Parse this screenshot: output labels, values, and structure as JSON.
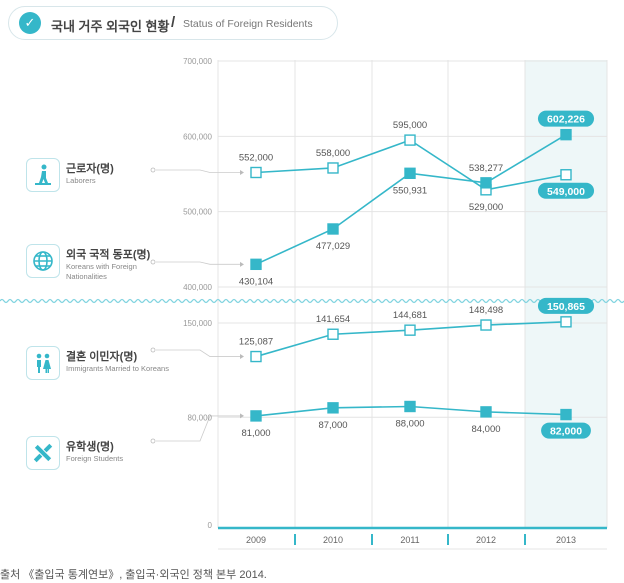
{
  "title": {
    "ko": "국내 거주 외국인 현황",
    "sep": "/",
    "en": "Status of Foreign Residents"
  },
  "categories": [
    {
      "ko": "근로자(명)",
      "en": "Laborers",
      "icon": "worker-icon"
    },
    {
      "ko": "외국 국적 동포(명)",
      "en": "Koreans with Foreign Nationalities",
      "icon": "globe-icon"
    },
    {
      "ko": "결혼 이민자(명)",
      "en": "Immigrants Married to Koreans",
      "icon": "couple-icon"
    },
    {
      "ko": "유학생(명)",
      "en": "Foreign Students",
      "icon": "pencil-ruler-icon"
    }
  ],
  "source": "출처 《출입국 통계연보》, 출입국·외국인 정책 본부 2014.",
  "colors": {
    "accent": "#35b7c9",
    "grid": "#e4e4e4",
    "highlight_bg": "#eef7f8"
  },
  "chart_data": [
    {
      "type": "line",
      "x": [
        "2009",
        "2010",
        "2011",
        "2012",
        "2013"
      ],
      "ylim": [
        400000,
        700000
      ],
      "ticks": [
        "400,000",
        "500,000",
        "600,000",
        "700,000"
      ],
      "grid": true,
      "series": [
        {
          "name": "근로자(명)",
          "marker": "hollow-square",
          "values": [
            552000,
            558000,
            595000,
            529000,
            549000
          ],
          "labels": [
            "552,000",
            "558,000",
            "595,000",
            "529,000",
            "549,000"
          ]
        },
        {
          "name": "외국 국적 동포(명)",
          "marker": "filled-square",
          "values": [
            430104,
            477029,
            550931,
            538277,
            602226
          ],
          "labels": [
            "430,104",
            "477,029",
            "550,931",
            "538,277",
            "602,226"
          ]
        }
      ]
    },
    {
      "type": "line",
      "x": [
        "2009",
        "2010",
        "2011",
        "2012",
        "2013"
      ],
      "ylim": [
        0,
        150000
      ],
      "ticks": [
        "0",
        "80,000",
        "150,000"
      ],
      "grid": true,
      "series": [
        {
          "name": "결혼 이민자(명)",
          "marker": "hollow-square",
          "values": [
            125087,
            141654,
            144681,
            148498,
            150865
          ],
          "labels": [
            "125,087",
            "141,654",
            "144,681",
            "148,498",
            "150,865"
          ]
        },
        {
          "name": "유학생(명)",
          "marker": "filled-square",
          "values": [
            81000,
            87000,
            88000,
            84000,
            82000
          ],
          "labels": [
            "81,000",
            "87,000",
            "88,000",
            "84,000",
            "82,000"
          ]
        }
      ]
    }
  ]
}
